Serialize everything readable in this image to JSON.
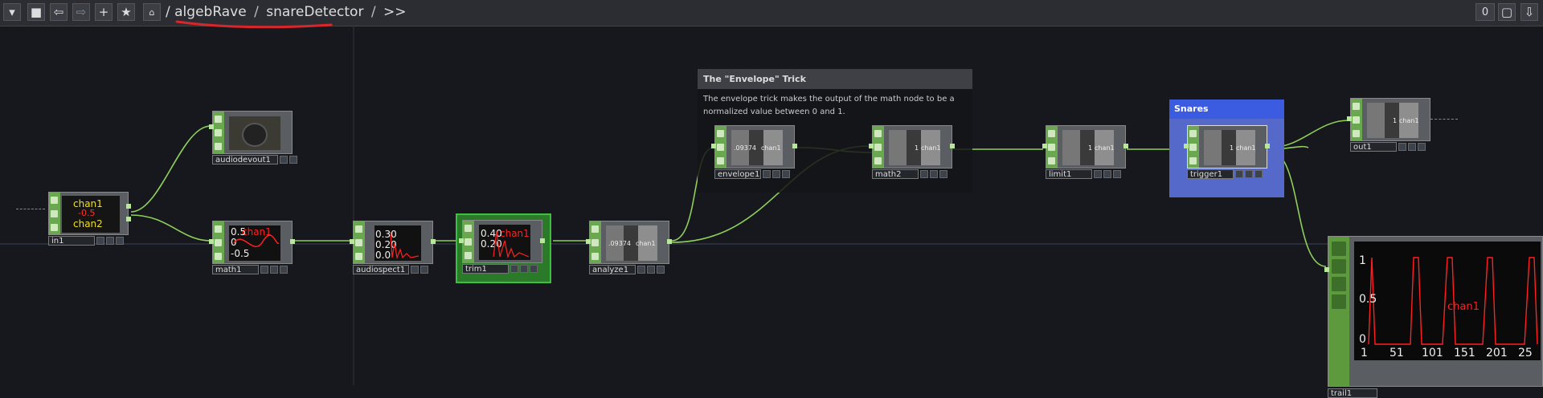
{
  "toolbar": {
    "path_root": "/",
    "path_project": "algebRave",
    "path_component": "snareDetector",
    "path_more": ">>",
    "counter": "0"
  },
  "nodes": {
    "in1": {
      "name": "in1",
      "channels": [
        "chan1",
        "-0.5",
        "chan2"
      ]
    },
    "audiodevout1": {
      "name": "audiodevout1"
    },
    "math1": {
      "name": "math1",
      "values": [
        "0.5",
        "0",
        "-0.5"
      ],
      "channel": "chan1"
    },
    "audiospect1": {
      "name": "audiospect1",
      "values": [
        "0.30",
        "0.20",
        "0.0"
      ]
    },
    "trim1": {
      "name": "trim1",
      "values": [
        "0.40",
        "0.20"
      ],
      "channel": "chan1"
    },
    "analyze1": {
      "name": "analyze1",
      "value": ".09374",
      "channel": "chan1"
    },
    "envelope1": {
      "name": "envelope1",
      "value": ".09374",
      "channel": "chan1"
    },
    "math2": {
      "name": "math2",
      "value": "1",
      "channel": "chan1"
    },
    "limit1": {
      "name": "limit1",
      "value": "1",
      "channel": "chan1"
    },
    "trigger1": {
      "name": "trigger1",
      "value": "1",
      "channel": "chan1"
    },
    "out1": {
      "name": "out1",
      "value": "1",
      "channel": "chan1"
    },
    "trail1": {
      "name": "trail1",
      "channel": "chan1",
      "y_ticks": [
        "1",
        "0.5",
        "0"
      ],
      "x_ticks": [
        "1",
        "51",
        "101",
        "151",
        "201",
        "25"
      ]
    }
  },
  "annotation": {
    "title": "The \"Envelope\" Trick",
    "body": "The envelope trick makes the output of the math node to be a normalized value between 0 and 1."
  },
  "snares_group": {
    "title": "Snares"
  },
  "colors": {
    "wire": "#8fcf5a",
    "node_strip": "#6aa84f",
    "selected": "#3fbf3f",
    "snares": "#3b5ce0",
    "underline": "#d9262b",
    "signal": "#ff2020"
  }
}
